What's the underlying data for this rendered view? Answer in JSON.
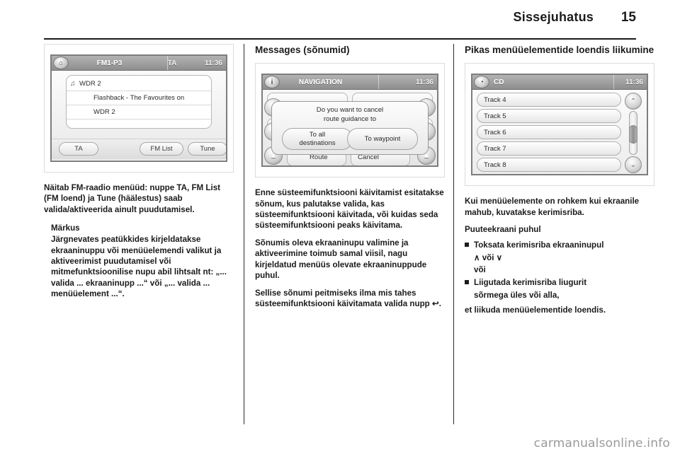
{
  "header": {
    "title": "Sissejuhatus",
    "page_number": "15"
  },
  "column1": {
    "radio_screen": {
      "status": {
        "home_icon": "home-icon",
        "preset": "FM1-P3",
        "ta": "TA",
        "clock": "11:36"
      },
      "info_lines": [
        "WDR 2",
        "Flashback - The Favourites on",
        "WDR 2"
      ],
      "music_glyph": "♫",
      "buttons": [
        "TA",
        "FM List",
        "Tune"
      ]
    },
    "caption": "Näitab FM-raadio menüüd: nuppe TA, FM List (FM loend) ja Tune (häälestus) saab valida/aktiveerida ainult puudutamisel.",
    "note": {
      "title": "Märkus",
      "body": "Järgnevates peatükkides kirjeldatakse ekraaninuppu või menüüelemendi valikut ja aktiveerimist puudutamisel või mitmefunktsioonilise nupu abil lihtsalt nt: „... valida ... ekraaninupp ...“ või „... valida ... menüüelement ...“."
    }
  },
  "column2": {
    "heading": "Messages (sõnumid)",
    "nav_screen": {
      "status": {
        "info_icon": "info-icon",
        "title": "NAVIGATION",
        "clock": "11:36"
      },
      "dialog": {
        "line1": "Do you want to cancel",
        "line2": "route guidance to",
        "choice_left_line1": "To all",
        "choice_left_line2": "destinations",
        "choice_right": "To waypoint"
      },
      "bottom_buttons": [
        "Route",
        "Cancel"
      ],
      "side_icons": [
        "arrow-left-icon",
        "arrow-left-icon",
        "arrow-up-icon",
        "arrow-right-icon"
      ]
    },
    "paragraphs": [
      "Enne süsteemifunktsiooni käivitamist esitatakse sõnum, kus palutakse valida, kas süsteemifunktsiooni käivitada, või kuidas seda süsteemifunktsiooni peaks käivitama.",
      "Sõnumis oleva ekraaninupu valimine ja aktiveerimine toimub samal viisil, nagu kirjeldatud menüüs olevate ekraaninuppude puhul.",
      "Sellise sõnumi peitmiseks ilma mis tahes süsteemifunktsiooni käivitamata valida nupp ↩."
    ]
  },
  "column3": {
    "heading": "Pikas menüüelementide loendis liikumine",
    "cd_screen": {
      "status": {
        "cd_icon": "cd-icon",
        "title": "CD",
        "clock": "11:36"
      },
      "tracks": [
        "Track 4",
        "Track 5",
        "Track 6",
        "Track 7",
        "Track 8"
      ],
      "scroll_up_icon": "chevron-up-icon",
      "scroll_down_icon": "chevron-down-icon"
    },
    "paragraph_intro": "Kui menüüelemente on rohkem kui ekraanile mahub, kuvatakse kerimisriba.",
    "subheading": "Puuteekraani puhul",
    "bullets": [
      "Toksata kerimisriba ekraaninupul",
      "Liigutada kerimisriba liugurit"
    ],
    "bullet1_sub": "∧ või ∨",
    "or_label": "või",
    "bullet2_sub": "sõrmega üles või alla,",
    "closing": "et liikuda menüüelementide loendis."
  },
  "watermark": "carmanualsonline.info"
}
